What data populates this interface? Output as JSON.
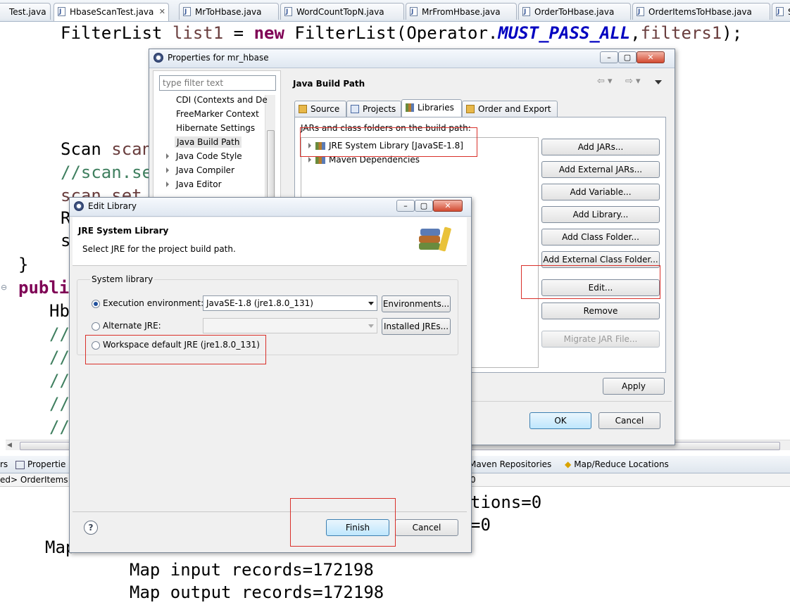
{
  "editor_tabs": [
    "Test.java",
    "HbaseScanTest.java",
    "MrToHbase.java",
    "WordCountTopN.java",
    "MrFromHbase.java",
    "OrderToHbase.java",
    "OrderItemsToHbase.java",
    "S"
  ],
  "code": {
    "line1_pre": "FilterList ",
    "line1_var": "list1",
    "line1_eq": " = ",
    "line1_new": "new",
    "line1_mid": " FilterList(Operator.",
    "line1_const": "MUST_PASS_ALL",
    "line1_sep": ",",
    "line1_var2": "filters1",
    "line1_end": ");",
    "scan_pre": "Scan ",
    "scan_var": "scan",
    "comment1": "//scan.se",
    "scan_set": "scan.set",
    "r_line": "R",
    "s_line": "s",
    "brace": "}",
    "publi": "publi",
    "hb": "Hb",
    "slashes": "//",
    "map_output_partial_1": "tions=0",
    "map_output_partial_2": "=0",
    "map_prefix": "Map",
    "map_input": "Map input records=172198",
    "map_output": "Map output records=172198"
  },
  "bottom_tabs": {
    "left_partial": "rs",
    "properties": "Propertie",
    "maven": "Maven Repositories",
    "mapreduce": "Map/Reduce Locations",
    "console_line": "ed> OrderItems",
    "console_line_right": "0"
  },
  "properties_dialog": {
    "title": "Properties for mr_hbase",
    "filter_placeholder": "type filter text",
    "tree": [
      "CDI (Contexts and De",
      "FreeMarker Context",
      "Hibernate Settings",
      "Java Build Path",
      "Java Code Style",
      "Java Compiler",
      "Java Editor"
    ],
    "tree_expandable": [
      false,
      false,
      false,
      false,
      true,
      true,
      true
    ],
    "section_title": "Java Build Path",
    "tabs": [
      "Source",
      "Projects",
      "Libraries",
      "Order and Export"
    ],
    "active_tab": "Libraries",
    "jars_label": "JARs and class folders on the build path:",
    "libraries": [
      "JRE System Library [JavaSE-1.8]",
      "Maven Dependencies"
    ],
    "buttons": [
      "Add JARs...",
      "Add External JARs...",
      "Add Variable...",
      "Add Library...",
      "Add Class Folder...",
      "Add External Class Folder...",
      "Edit...",
      "Remove",
      "Migrate JAR File..."
    ],
    "apply": "Apply",
    "ok": "OK",
    "cancel": "Cancel"
  },
  "edit_library_dialog": {
    "title": "Edit Library",
    "header_title": "JRE System Library",
    "header_desc": "Select JRE for the project build path.",
    "group_label": "System library",
    "exec_env_label": "Execution environment:",
    "exec_env_value": "JavaSE-1.8 (jre1.8.0_131)",
    "environments_btn": "Environments...",
    "alt_jre_label": "Alternate JRE:",
    "alt_jre_value": "",
    "installed_btn": "Installed JREs...",
    "workspace_label": "Workspace default JRE (jre1.8.0_131)",
    "selected_option": "execution-environment",
    "finish": "Finish",
    "cancel": "Cancel",
    "help": "?"
  }
}
